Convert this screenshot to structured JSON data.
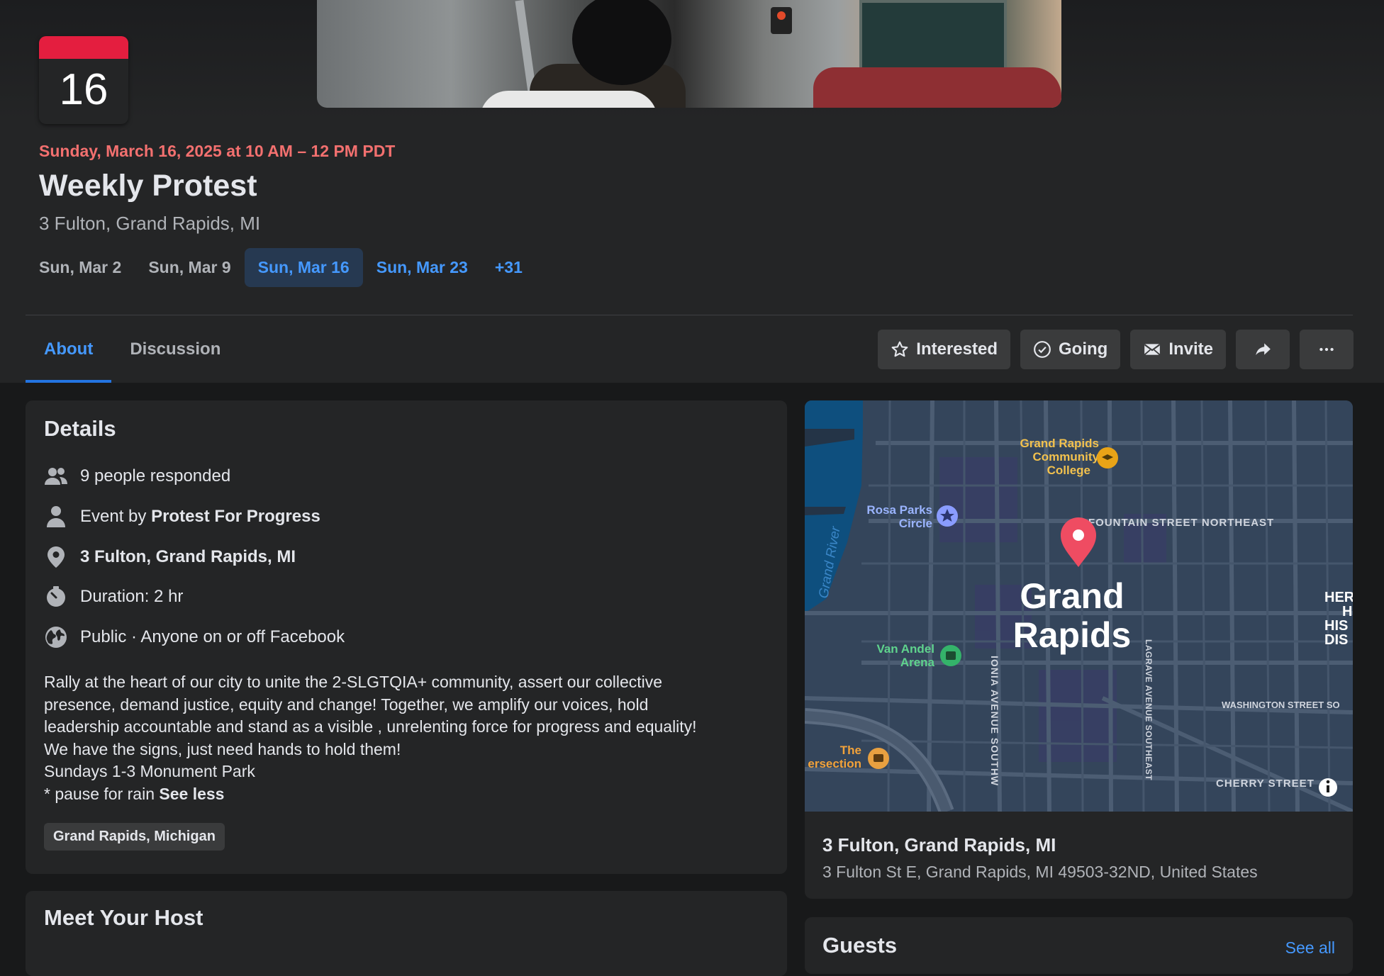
{
  "event": {
    "calendar_day": "16",
    "date_line": "Sunday, March 16, 2025 at 10 AM – 12 PM PDT",
    "title": "Weekly Protest",
    "location": "3 Fulton, Grand Rapids, MI"
  },
  "date_chips": [
    {
      "label": "Sun, Mar 2"
    },
    {
      "label": "Sun, Mar 9"
    },
    {
      "label": "Sun, Mar 16"
    },
    {
      "label": "Sun, Mar 23"
    },
    {
      "label": "+31"
    }
  ],
  "tabs": {
    "about": "About",
    "discussion": "Discussion"
  },
  "actions": {
    "interested": "Interested",
    "going": "Going",
    "invite": "Invite"
  },
  "details": {
    "heading": "Details",
    "responded": "9 people responded",
    "event_by_prefix": "Event by ",
    "event_by_name": "Protest For Progress",
    "address": "3 Fulton, Grand Rapids, MI",
    "duration": "Duration: 2 hr",
    "privacy": "Public · Anyone on or off Facebook",
    "description": [
      "Rally at the heart of our city to unite the 2-SLGTQIA+ community, assert our collective",
      "presence, demand justice, equity and change! Together, we amplify our voices, hold",
      "leadership accountable and stand as a visible , unrelenting force for progress and equality!",
      "We have the signs, just need hands to hold them!",
      "Sundays 1-3 Monument Park"
    ],
    "last_line": "* pause for rain ",
    "see_less": "See less",
    "tag": "Grand Rapids, Michigan"
  },
  "host": {
    "heading": "Meet Your Host"
  },
  "map": {
    "labels": {
      "college": [
        "Grand Rapids",
        "Community",
        "College"
      ],
      "rosa": [
        "Rosa Parks",
        "Circle"
      ],
      "fountain": "FOUNTAIN STREET NORTHEAST",
      "river": "Grand River",
      "city": [
        "Grand",
        "Rapids"
      ],
      "van_andel": [
        "Van Andel",
        "Arena"
      ],
      "ionia": "IONIA AVENUE SOUTHW",
      "lagrave": "LAGRAVE AVENUE SOUTHEAST",
      "washington": "WASHINGTON STREET SO",
      "cherry": "CHERRY STREET",
      "intersection": [
        "The",
        "ersection"
      ],
      "heritage": [
        "HER",
        "H",
        "HIS",
        "DIS"
      ]
    },
    "address_title": "3 Fulton, Grand Rapids, MI",
    "address_full": "3 Fulton St E, Grand Rapids, MI 49503-32ND, United States"
  },
  "guests": {
    "heading": "Guests",
    "see_all": "See all"
  },
  "colors": {
    "accent_blue": "#4599ff",
    "date_red": "#f3706f",
    "calendar_red": "#e41e3f",
    "card_bg": "#242526",
    "page_bg": "#18191a"
  }
}
